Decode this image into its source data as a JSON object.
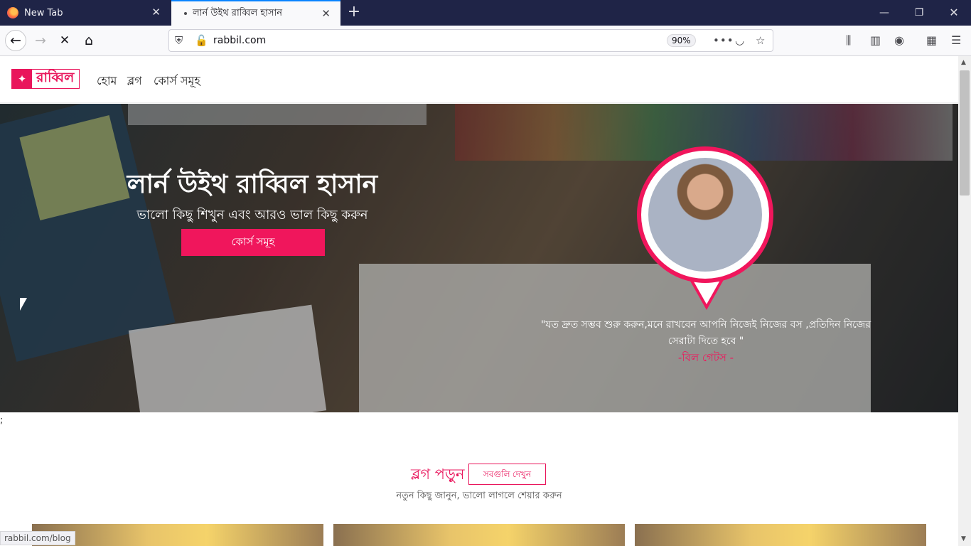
{
  "browser": {
    "tabs": [
      {
        "title": "New Tab",
        "active": false
      },
      {
        "title": "লার্ন উইথ রাব্বিল হাসান",
        "active": true
      }
    ],
    "url": "rabbil.com",
    "zoom": "90%",
    "status_url": "rabbil.com/blog"
  },
  "site": {
    "logo": "রাব্বিল",
    "menu": [
      "হোম",
      "ব্লগ",
      "কোর্স সমূহ"
    ]
  },
  "hero": {
    "title": "লার্ন উইথ রাব্বিল হাসান",
    "subtitle": "ভালো কিছু শিখুন এবং আরও ভাল কিছু করুন",
    "cta": "কোর্স সমূহ",
    "quote": "\"যত দ্রুত সম্ভব শুরু করুন,মনে রাখবেন আপনি নিজেই নিজের বস ,প্রতিদিন নিজের সেরাটা দিতে হবে \"",
    "quote_author": "-বিল গেটস -"
  },
  "misc": {
    "semicolon": ";"
  },
  "blog": {
    "heading": "ব্লগ পড়ুন",
    "see_all": "সবগুলি দেখুন",
    "subtitle": "নতুন কিছু জানুন, ভালো লাগলে শেয়ার করুন"
  },
  "colors": {
    "brand": "#e9165c",
    "tab_bar": "#1f2447"
  }
}
